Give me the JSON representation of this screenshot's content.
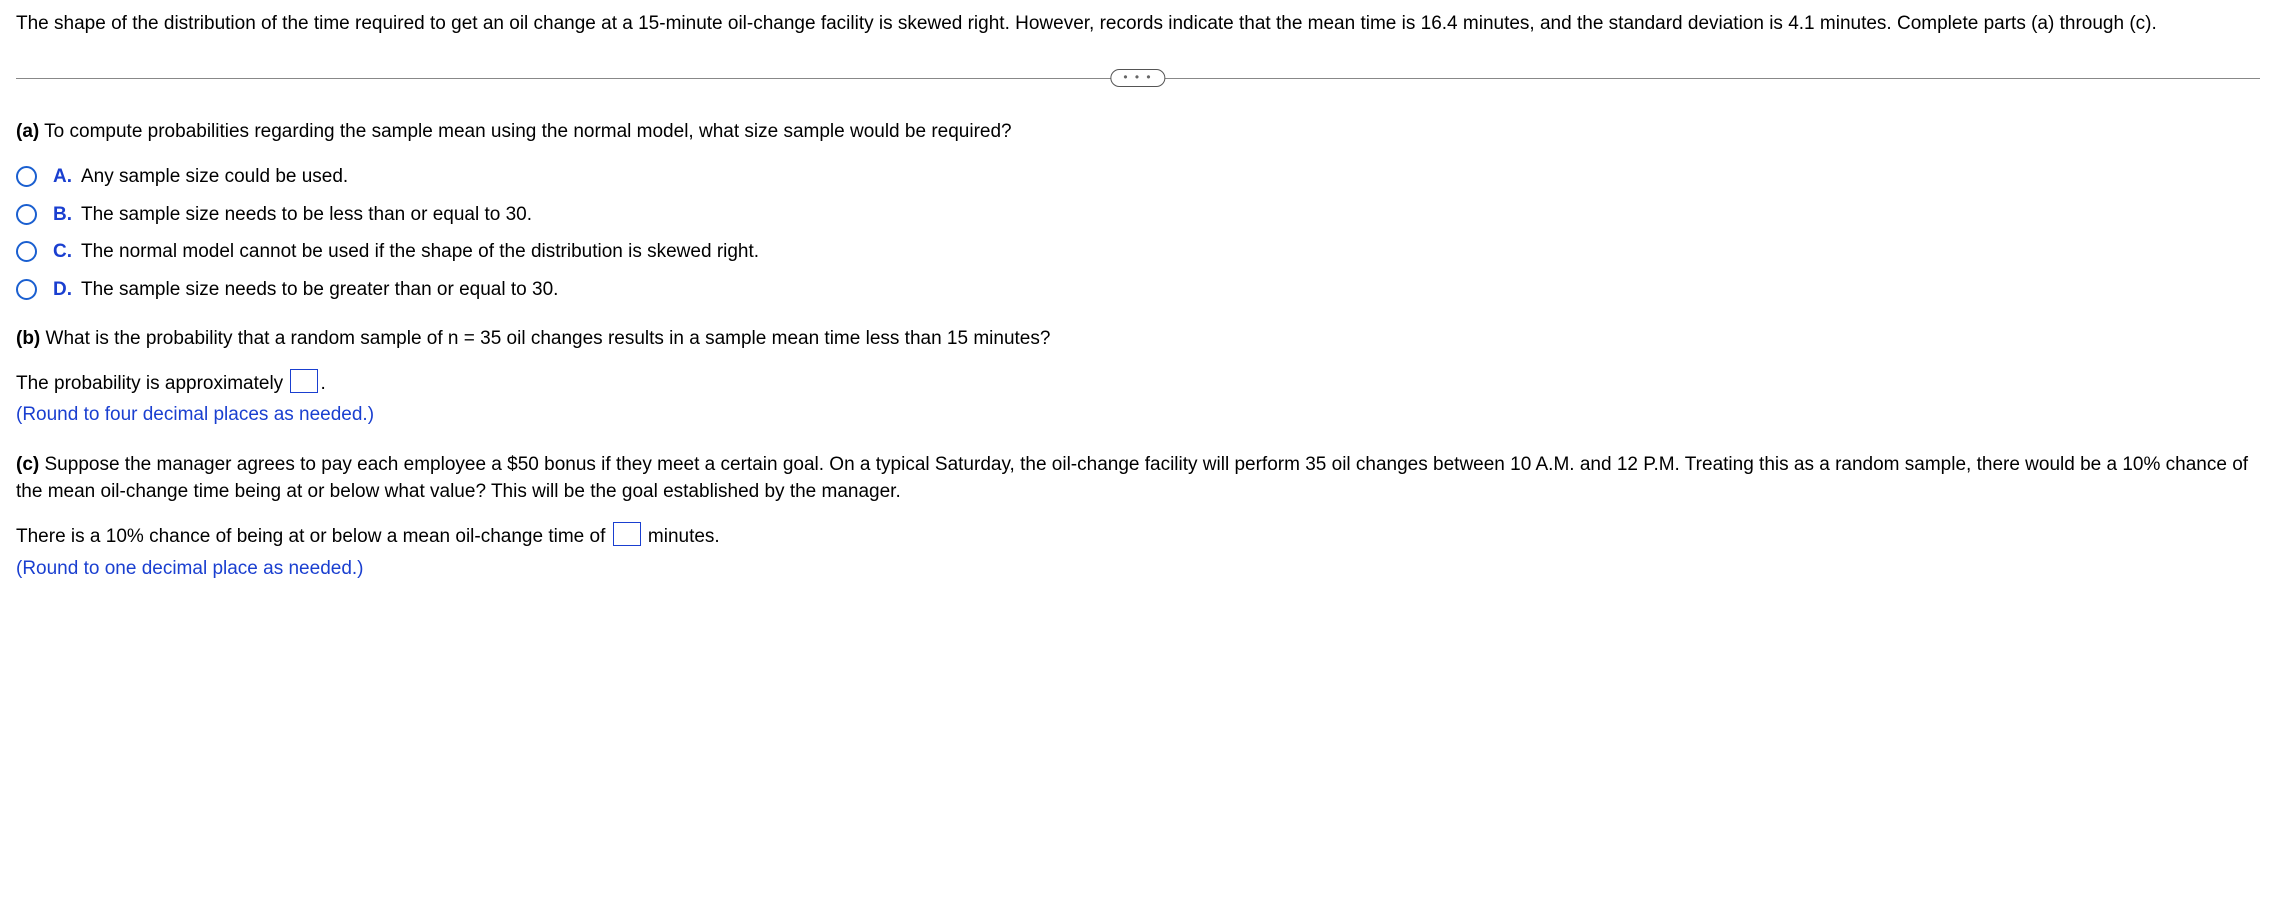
{
  "intro": "The shape of the distribution of the time required to get an oil change at a 15-minute oil-change facility is skewed right. However, records indicate that the mean time is 16.4 minutes, and the standard deviation is 4.1 minutes. Complete parts (a) through (c).",
  "divider_dots": "• • •",
  "part_a": {
    "label": "(a)",
    "text": " To compute probabilities regarding the sample mean using the normal model, what size sample would be required?",
    "options": [
      {
        "letter": "A.",
        "text": "Any sample size could be used."
      },
      {
        "letter": "B.",
        "text": "The sample size needs to be less than or equal to 30."
      },
      {
        "letter": "C.",
        "text": "The normal model cannot be used if the shape of the distribution is skewed right."
      },
      {
        "letter": "D.",
        "text": "The sample size needs to be greater than or equal to 30."
      }
    ]
  },
  "part_b": {
    "label": "(b)",
    "text": " What is the probability that a random sample of n = 35 oil changes results in a sample mean time less than 15 minutes?",
    "answer_before": "The probability is approximately ",
    "answer_after": ".",
    "hint": "(Round to four decimal places as needed.)",
    "value": ""
  },
  "part_c": {
    "label": "(c)",
    "text": " Suppose the manager agrees to pay each employee a $50 bonus if they meet a certain goal. On a typical Saturday, the oil-change facility will perform 35 oil changes between 10 A.M. and 12 P.M. Treating this as a random sample, there would be a 10% chance of the mean oil-change time being at or below what value? This will be the goal established by the manager.",
    "answer_before": "There is a 10% chance of being at or below a mean oil-change time of ",
    "answer_after": " minutes.",
    "hint": "(Round to one decimal place as needed.)",
    "value": ""
  }
}
